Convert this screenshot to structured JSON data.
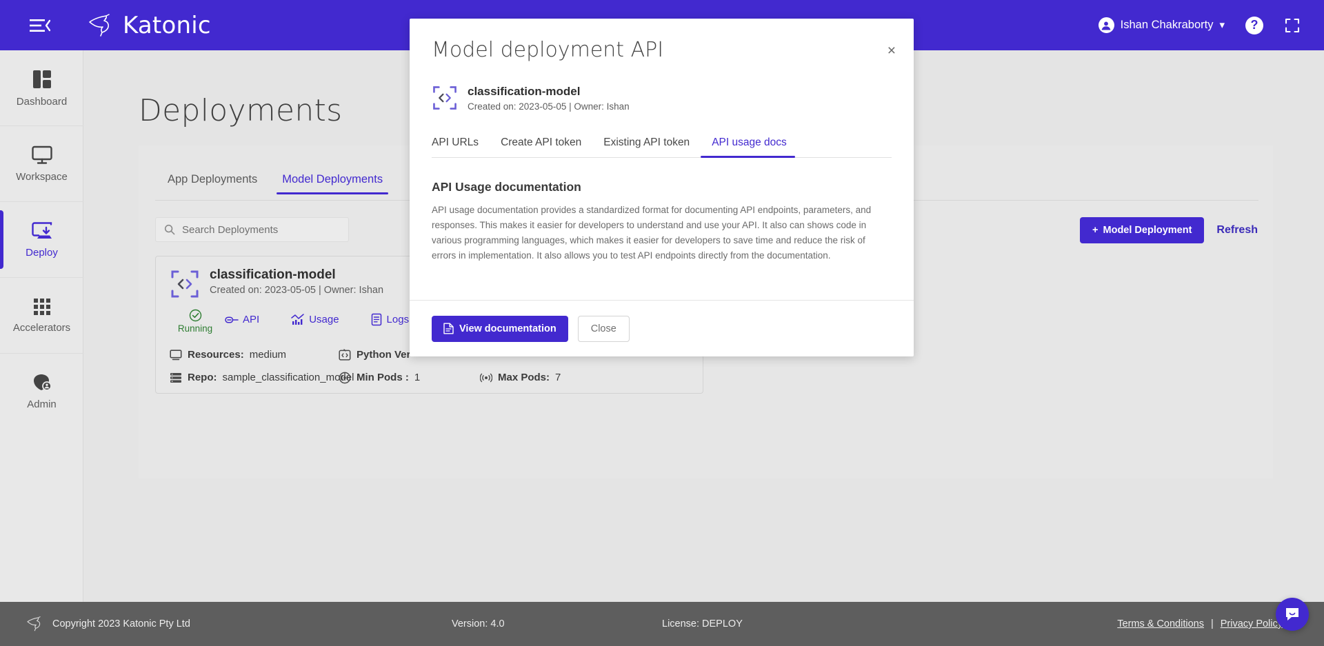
{
  "topbar": {
    "menu_icon": "hamburger-menu-icon",
    "brand": "Katonic",
    "user_name": "Ishan Chakraborty",
    "help_icon": "help-question-icon",
    "fullscreen_icon": "fullscreen-expand-icon"
  },
  "sidebar": {
    "items": [
      {
        "label": "Dashboard",
        "icon": "dashboard-grid-icon",
        "active": false
      },
      {
        "label": "Workspace",
        "icon": "monitor-icon",
        "active": false
      },
      {
        "label": "Deploy",
        "icon": "deploy-download-icon",
        "active": true
      },
      {
        "label": "Accelerators",
        "icon": "apps-grid-icon",
        "active": false
      },
      {
        "label": "Admin",
        "icon": "admin-user-shield-icon",
        "active": false
      }
    ]
  },
  "page": {
    "title": "Deployments",
    "tabs": [
      {
        "label": "App Deployments",
        "active": false
      },
      {
        "label": "Model Deployments",
        "active": true
      }
    ],
    "search": {
      "placeholder": "Search Deployments",
      "value": "",
      "icon": "search-icon"
    },
    "add_button": {
      "label": "Model Deployment",
      "plus": "+"
    },
    "refresh_label": "Refresh"
  },
  "deployment_card": {
    "icon": "code-brackets-icon",
    "name": "classification-model",
    "meta": "Created on: 2023-05-05 | Owner: Ishan",
    "status": {
      "label": "Running",
      "icon": "check-circle-icon",
      "color": "#2e7d32"
    },
    "links": [
      {
        "label": "API",
        "icon": "link-chain-icon"
      },
      {
        "label": "Usage",
        "icon": "chart-bars-icon"
      },
      {
        "label": "Logs",
        "icon": "document-lines-icon"
      }
    ],
    "details": [
      [
        {
          "key": "Resources:",
          "value": "medium",
          "icon": "monitor-icon"
        },
        {
          "key": "Python Ver",
          "value": "",
          "icon": "code-box-icon"
        }
      ],
      [
        {
          "key": "Repo:",
          "value": "sample_classification_model",
          "icon": "server-stack-icon"
        },
        {
          "key": "Min Pods :",
          "value": "1",
          "icon": "pods-signal-icon"
        },
        {
          "key": "Max Pods:",
          "value": "7",
          "icon": "pods-signal-icon"
        }
      ]
    ]
  },
  "modal": {
    "title": "Model deployment API",
    "close_icon": "close-x-icon",
    "model": {
      "icon": "code-brackets-icon",
      "name": "classification-model",
      "meta": "Created on: 2023-05-05 | Owner: Ishan"
    },
    "tabs": [
      {
        "label": "API URLs",
        "active": false
      },
      {
        "label": "Create API token",
        "active": false
      },
      {
        "label": "Existing API token",
        "active": false
      },
      {
        "label": "API usage docs",
        "active": true
      }
    ],
    "section_title": "API Usage documentation",
    "section_text": "API usage documentation provides a standardized format for documenting API endpoints, parameters, and responses. This makes it easier for developers to understand and use your API. It also can shows code in various programming languages, which makes it easier for developers to save time and reduce the risk of errors in implementation. It also allows you to test API endpoints directly from the documentation.",
    "primary_button": {
      "label": "View documentation",
      "icon": "document-icon"
    },
    "secondary_button": {
      "label": "Close"
    }
  },
  "footer": {
    "copyright": "Copyright 2023 Katonic Pty Ltd",
    "version": "Version: 4.0",
    "license": "License: DEPLOY",
    "terms": "Terms & Conditions",
    "separator": "|",
    "privacy": "Privacy Policy"
  },
  "chat": {
    "icon": "chat-bubble-icon"
  },
  "colors": {
    "brand": "#4229cf",
    "footer_bg": "#5e5e5e",
    "status_green": "#2e7d32"
  }
}
